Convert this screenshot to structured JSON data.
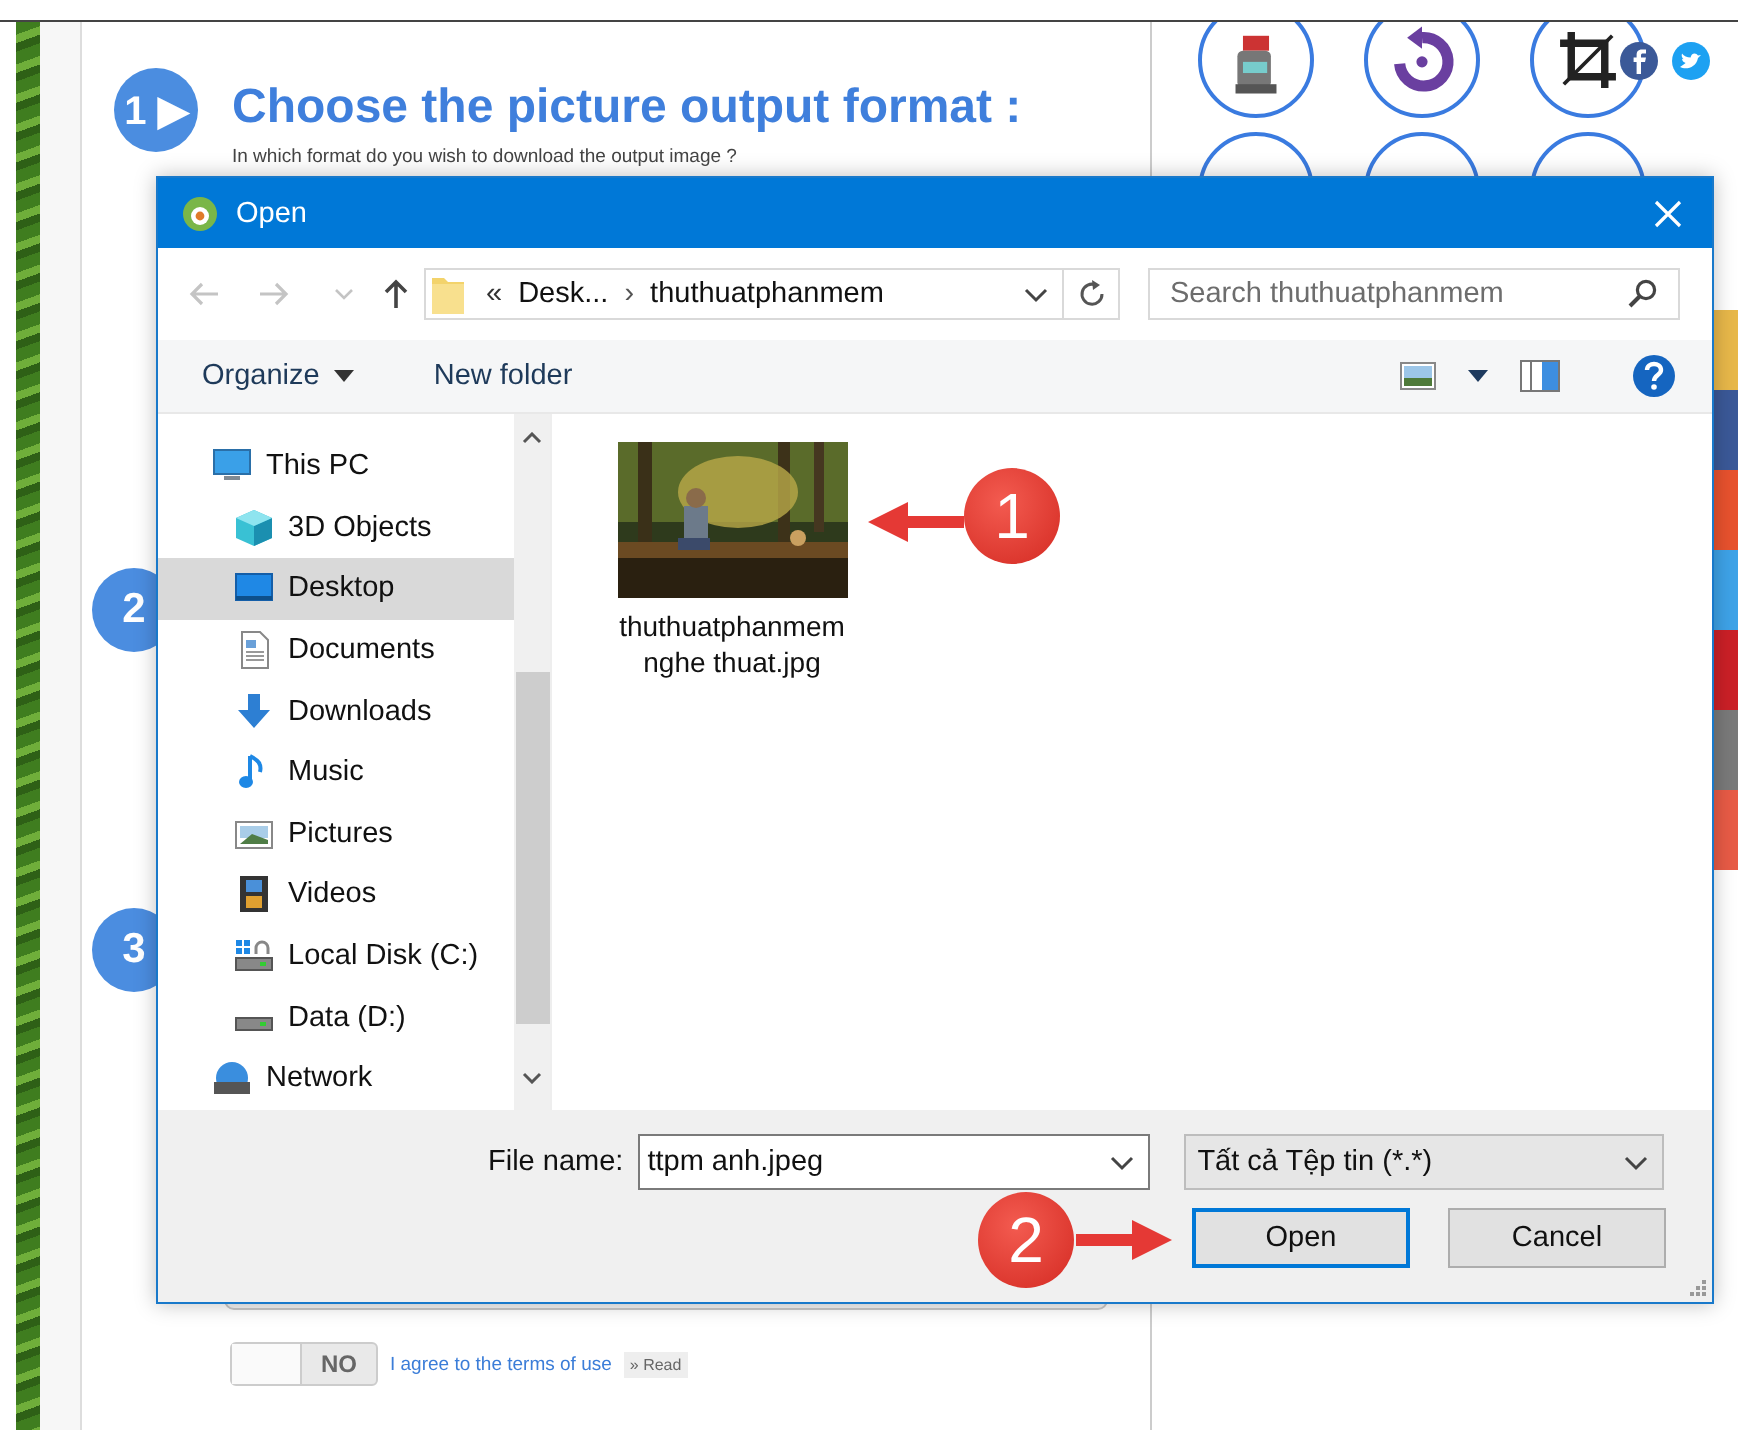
{
  "page": {
    "steps": [
      {
        "number": "1",
        "arrow": "▶",
        "title": "Choose the picture output format :",
        "subtitle": "In which format do you wish to download the output image ?"
      },
      {
        "number": "2"
      },
      {
        "number": "3"
      }
    ],
    "terms": {
      "toggle": "NO",
      "on": false,
      "link": "I agree to the terms of use",
      "read": "» Read"
    }
  },
  "dialog": {
    "title": "Open",
    "nav_buttons": [
      {
        "kind": "back",
        "disabled": true
      },
      {
        "kind": "forward",
        "disabled": true
      },
      {
        "kind": "recent",
        "disabled": true
      },
      {
        "kind": "up",
        "disabled": false
      }
    ],
    "address": {
      "overflow": "«",
      "separator": "›",
      "crumbs": [
        "Desk...",
        "thuthuatphanmem"
      ]
    },
    "search": {
      "placeholder": "Search thuthuatphanmem"
    },
    "toolbar": {
      "organize": "Organize",
      "new_folder": "New folder"
    },
    "sidebar": {
      "items": [
        {
          "label": "This PC",
          "kind": "pc",
          "selected": false,
          "children": [
            {
              "label": "3D Objects",
              "kind": "cube",
              "selected": false
            },
            {
              "label": "Desktop",
              "kind": "desktop",
              "selected": true
            },
            {
              "label": "Documents",
              "kind": "documents",
              "selected": false
            },
            {
              "label": "Downloads",
              "kind": "downloads",
              "selected": false
            },
            {
              "label": "Music",
              "kind": "music",
              "selected": false
            },
            {
              "label": "Pictures",
              "kind": "pictures",
              "selected": false
            },
            {
              "label": "Videos",
              "kind": "videos",
              "selected": false
            },
            {
              "label": "Local Disk (C:)",
              "kind": "disk-c",
              "selected": false
            },
            {
              "label": "Data (D:)",
              "kind": "disk-d",
              "selected": false
            }
          ]
        },
        {
          "label": "Network",
          "kind": "network",
          "selected": false
        }
      ]
    },
    "files": [
      {
        "name": "thuthuatphanmem nghe thuat.jpg",
        "kind": "picture"
      }
    ],
    "file_name": {
      "label": "File name:",
      "value": "ttpm anh.jpeg"
    },
    "filter": {
      "value": "Tất cả Tệp tin (*.*)"
    },
    "buttons": [
      {
        "label": "Open",
        "default": true
      },
      {
        "label": "Cancel",
        "default": false
      }
    ]
  },
  "annotations": [
    {
      "number": "1"
    },
    {
      "number": "2"
    }
  ]
}
